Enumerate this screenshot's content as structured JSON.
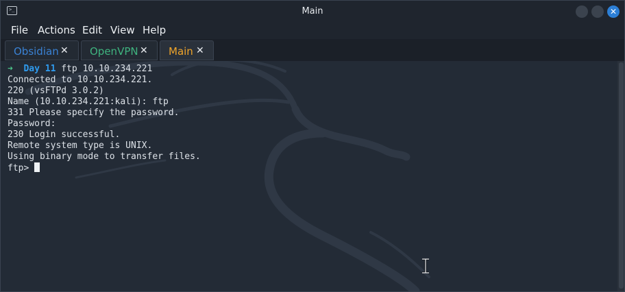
{
  "window": {
    "title": "Main"
  },
  "menu": {
    "items": [
      "File",
      "Actions",
      "Edit",
      "View",
      "Help"
    ]
  },
  "tabs": [
    {
      "label": "Obsidian",
      "color": "#3a82d4",
      "close": "✕"
    },
    {
      "label": "OpenVPN",
      "color": "#3fb37f",
      "close": "✕"
    },
    {
      "label": "Main",
      "color": "#f0a52a",
      "close": "✕"
    }
  ],
  "terminal": {
    "prompt_arrow": "➜",
    "prompt_dir": "Day 11",
    "command": "ftp 10.10.234.221",
    "output": [
      "Connected to 10.10.234.221.",
      "220 (vsFTPd 3.0.2)",
      "Name (10.10.234.221:kali): ftp",
      "331 Please specify the password.",
      "Password:",
      "230 Login successful.",
      "Remote system type is UNIX.",
      "Using binary mode to transfer files."
    ],
    "ftp_prompt": "ftp> "
  },
  "colors": {
    "accent": "#2c7fd6",
    "background": "#232b36"
  }
}
